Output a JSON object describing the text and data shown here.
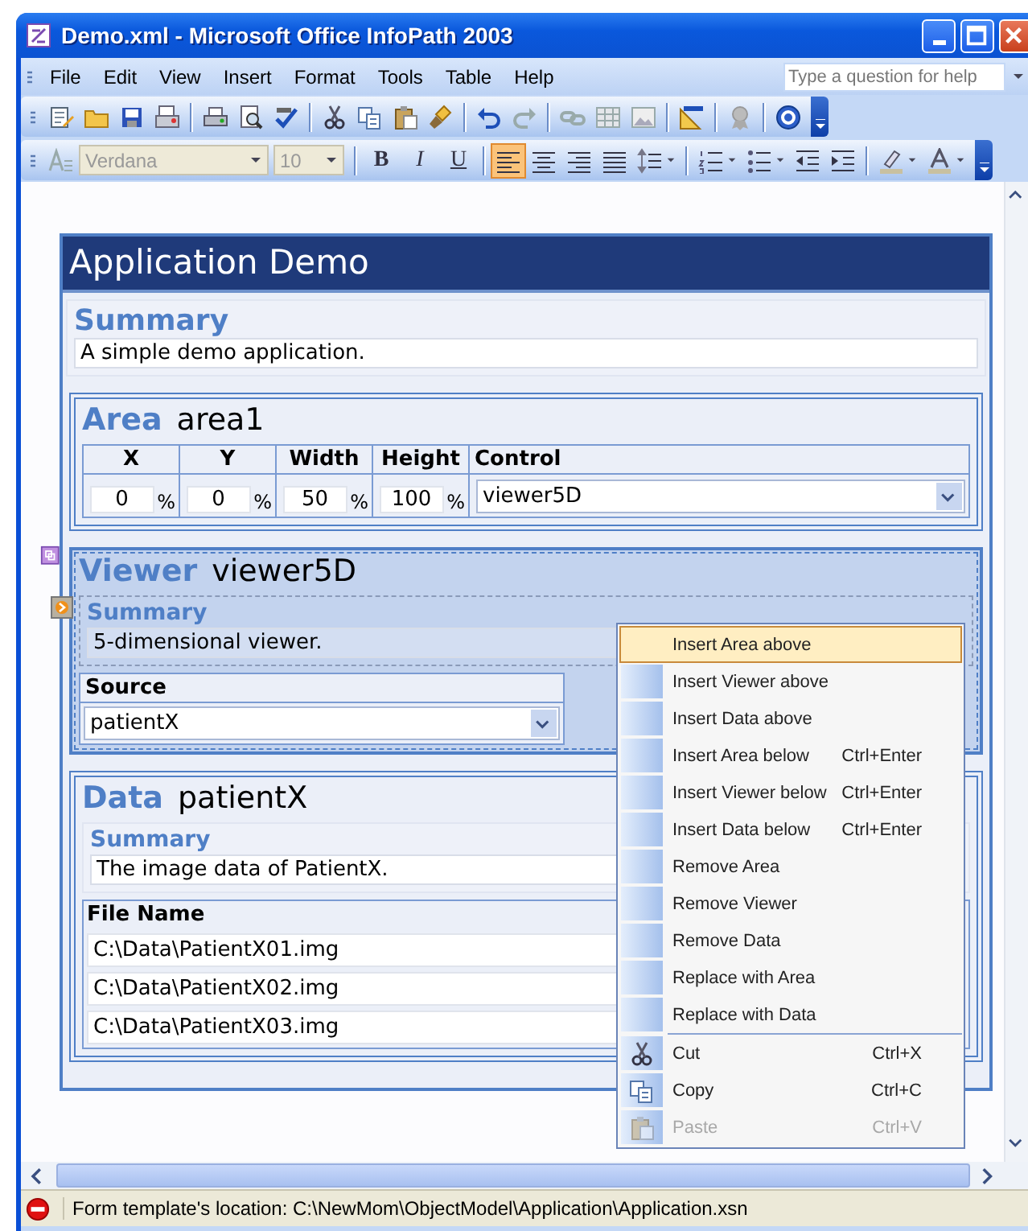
{
  "window": {
    "title": "Demo.xml - Microsoft Office InfoPath 2003"
  },
  "menu_bar": {
    "items": [
      "File",
      "Edit",
      "View",
      "Insert",
      "Format",
      "Tools",
      "Table",
      "Help"
    ],
    "help_box": {
      "placeholder": "Type a question for help"
    }
  },
  "formatting_toolbar": {
    "font": {
      "value": "Verdana",
      "disabled": true
    },
    "size": {
      "value": "10",
      "disabled": true
    },
    "style_buttons": [
      "B",
      "I",
      "U"
    ],
    "alignment": [
      {
        "selected": true
      },
      {
        "selected": false
      },
      {
        "selected": false
      },
      {
        "selected": false
      }
    ]
  },
  "form": {
    "title": "Application Demo",
    "summary": {
      "heading": "Summary",
      "text": "A simple demo application."
    },
    "sections": [
      {
        "kind": "area",
        "heading": "Area",
        "name": "area1",
        "selected": false,
        "columns": [
          "X",
          "Y",
          "Width",
          "Height",
          "Control"
        ],
        "fields": [
          {
            "value": "0",
            "unit": "%"
          },
          {
            "value": "0",
            "unit": "%"
          },
          {
            "value": "50",
            "unit": "%"
          },
          {
            "value": "100",
            "unit": "%"
          }
        ],
        "control": "viewer5D"
      },
      {
        "kind": "viewer",
        "heading": "Viewer",
        "name": "viewer5D",
        "selected": true,
        "summary": {
          "heading": "Summary",
          "text": "5-dimensional viewer."
        },
        "source": {
          "label": "Source",
          "value": "patientX"
        }
      },
      {
        "kind": "data",
        "heading": "Data",
        "name": "patientX",
        "selected": false,
        "summary": {
          "heading": "Summary",
          "text": "The image data of PatientX."
        },
        "files": {
          "column": "File Name",
          "rows": [
            "C:\\Data\\PatientX01.img",
            "C:\\Data\\PatientX02.img",
            "C:\\Data\\PatientX03.img"
          ]
        }
      }
    ]
  },
  "context_menu": {
    "groups": [
      [
        {
          "label": "Insert Area above",
          "selected": true,
          "disabled": false
        },
        {
          "label": "Insert Viewer above",
          "selected": false,
          "disabled": false
        },
        {
          "label": "Insert Data above",
          "selected": false,
          "disabled": false
        },
        {
          "label": "Insert Area below",
          "shortcut": "Ctrl+Enter",
          "selected": false,
          "disabled": false
        },
        {
          "label": "Insert Viewer below",
          "shortcut": "Ctrl+Enter",
          "selected": false,
          "disabled": false
        },
        {
          "label": "Insert Data below",
          "shortcut": "Ctrl+Enter",
          "selected": false,
          "disabled": false
        },
        {
          "label": "Remove Area",
          "selected": false,
          "disabled": false
        },
        {
          "label": "Remove Viewer",
          "selected": false,
          "disabled": false
        },
        {
          "label": "Remove Data",
          "selected": false,
          "disabled": false
        },
        {
          "label": "Replace with Area",
          "selected": false,
          "disabled": false
        },
        {
          "label": "Replace with Data",
          "selected": false,
          "disabled": false
        }
      ],
      [
        {
          "label": "Cut",
          "shortcut": "Ctrl+X",
          "selected": false,
          "disabled": false
        },
        {
          "label": "Copy",
          "shortcut": "Ctrl+C",
          "selected": false,
          "disabled": false
        },
        {
          "label": "Paste",
          "shortcut": "Ctrl+V",
          "selected": false,
          "disabled": true
        }
      ]
    ]
  },
  "status_bar": {
    "text": "Form template's location: C:\\NewMom\\ObjectModel\\Application\\Application.xsn"
  }
}
